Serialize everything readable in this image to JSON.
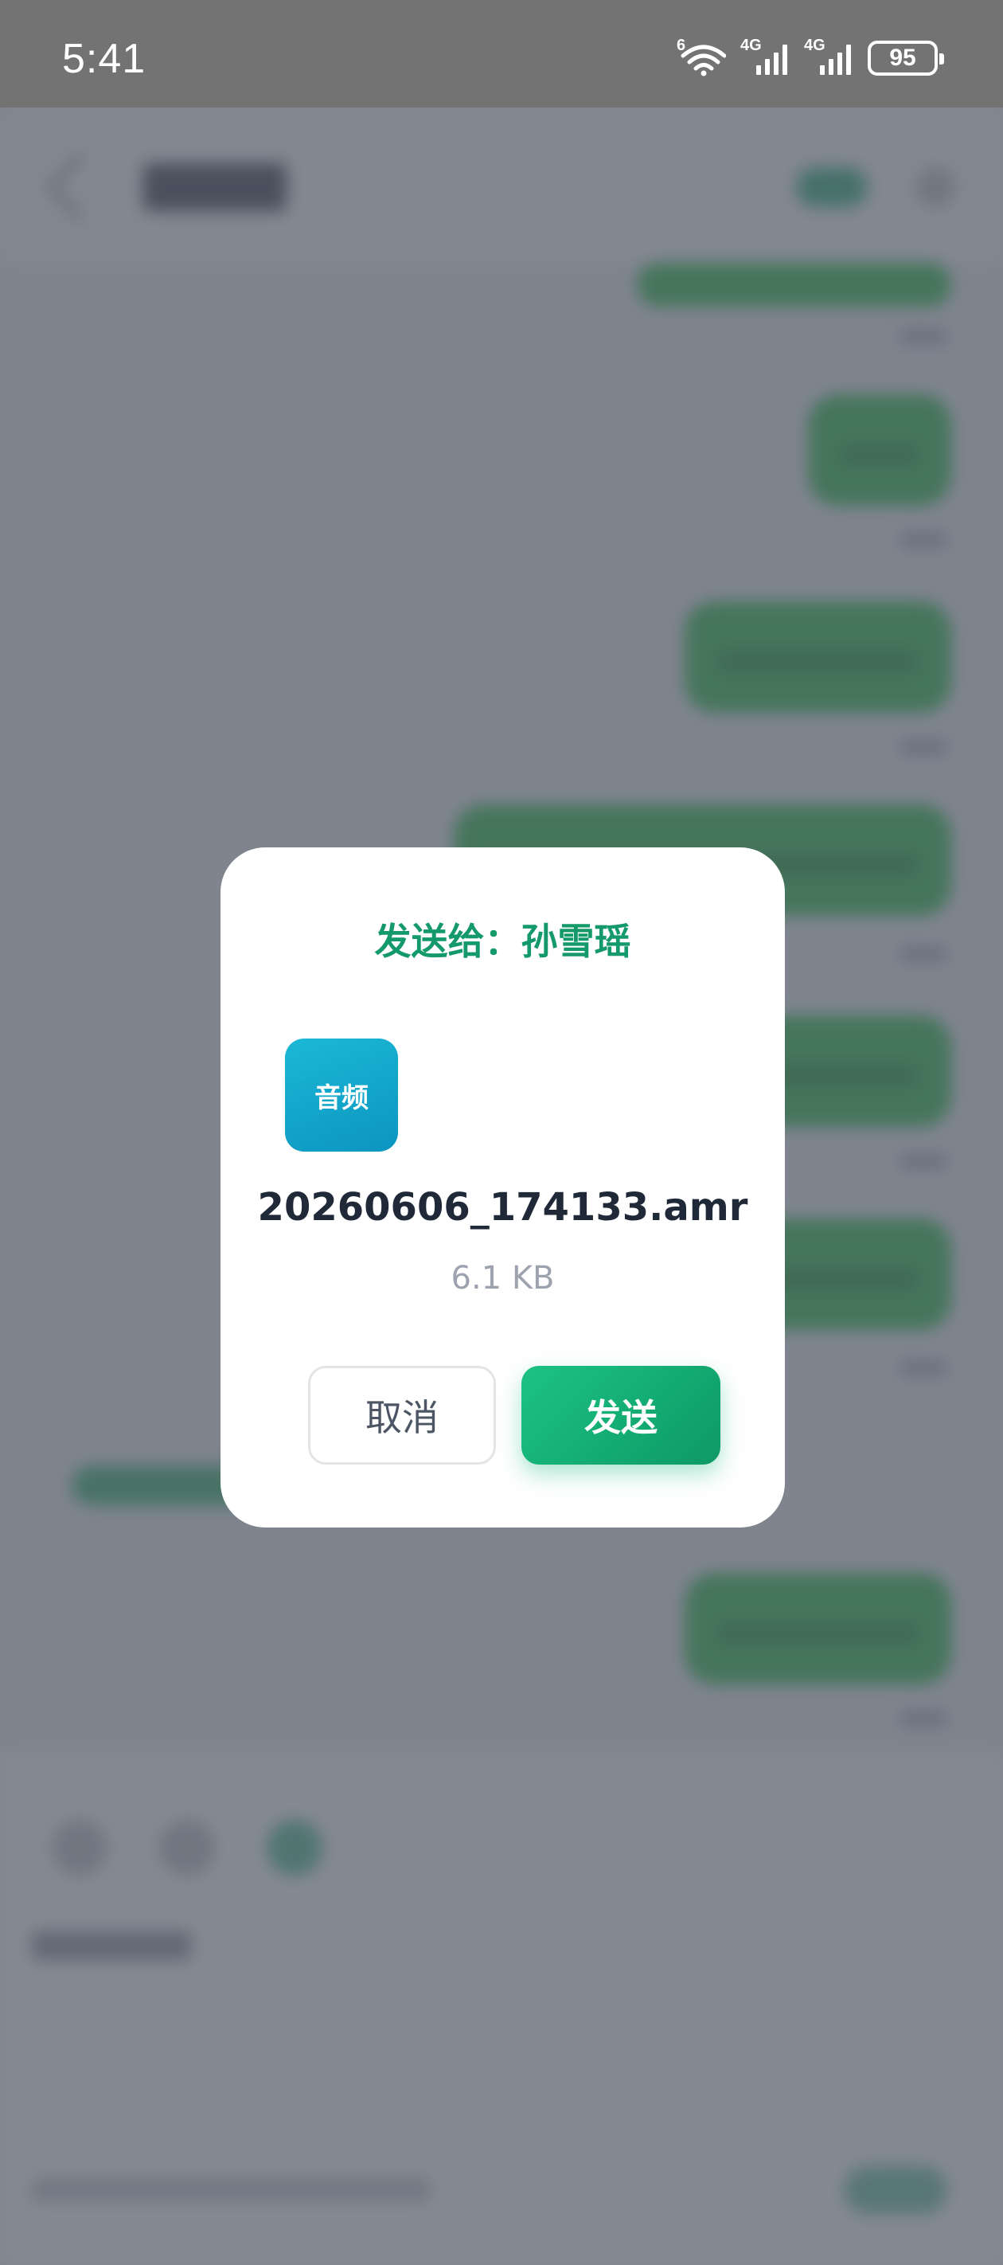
{
  "status_bar": {
    "time": "5:41",
    "wifi_label": "6",
    "sim1_label": "4G",
    "sim2_label": "4G",
    "battery": "95"
  },
  "dialog": {
    "title": "发送给：孙雪瑶",
    "file_icon_label": "音频",
    "file_name": "20260606_174133.amr",
    "file_size": "6.1 KB",
    "cancel_label": "取消",
    "send_label": "发送"
  },
  "colors": {
    "accent": "#14996a",
    "send_button": "#0d9966",
    "file_icon": "#0b95c0",
    "overlay": "#3e4452"
  }
}
